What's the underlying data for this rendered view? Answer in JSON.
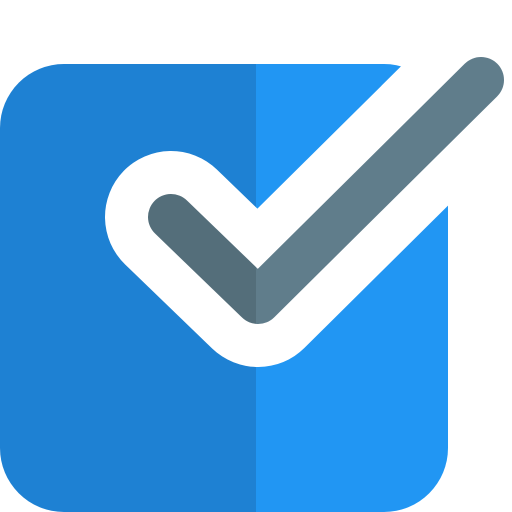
{
  "icon": {
    "name": "checkbox-checked-icon",
    "colors": {
      "box_left": "#1E81D3",
      "box_right": "#2196F3",
      "check_left": "#546E7A",
      "check_right": "#607D8B",
      "outline": "#FFFFFF",
      "background": "#FFFFFF"
    }
  }
}
